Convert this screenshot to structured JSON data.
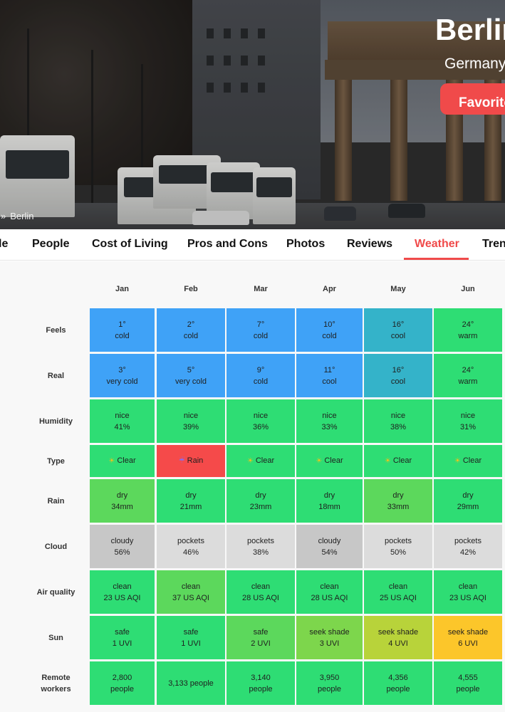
{
  "city": {
    "name": "Berlin",
    "country": "Germany",
    "favorite_label": "Favorite"
  },
  "breadcrumb": {
    "separator": "»",
    "current": "Berlin"
  },
  "tabs": [
    {
      "label": "le",
      "active": false
    },
    {
      "label": "People",
      "active": false
    },
    {
      "label": "Cost of Living",
      "active": false
    },
    {
      "label": "Pros and Cons",
      "active": false
    },
    {
      "label": "Photos",
      "active": false
    },
    {
      "label": "Reviews",
      "active": false
    },
    {
      "label": "Weather",
      "active": true
    },
    {
      "label": "Tren",
      "active": false
    }
  ],
  "months": [
    "Jan",
    "Feb",
    "Mar",
    "Apr",
    "May",
    "Jun"
  ],
  "rows": [
    {
      "label": "Feels",
      "cells": [
        {
          "l1": "1°",
          "l2": "cold",
          "color": "#3fa2f7"
        },
        {
          "l1": "2°",
          "l2": "cold",
          "color": "#3fa2f7"
        },
        {
          "l1": "7°",
          "l2": "cold",
          "color": "#3fa2f7"
        },
        {
          "l1": "10°",
          "l2": "cold",
          "color": "#3fa2f7"
        },
        {
          "l1": "16°",
          "l2": "cool",
          "color": "#34b3c9"
        },
        {
          "l1": "24°",
          "l2": "warm",
          "color": "#2edd74"
        }
      ]
    },
    {
      "label": "Real",
      "cells": [
        {
          "l1": "3°",
          "l2": "very cold",
          "color": "#3fa2f7"
        },
        {
          "l1": "5°",
          "l2": "very cold",
          "color": "#3fa2f7"
        },
        {
          "l1": "9°",
          "l2": "cold",
          "color": "#3fa2f7"
        },
        {
          "l1": "11°",
          "l2": "cool",
          "color": "#3fa2f7"
        },
        {
          "l1": "16°",
          "l2": "cool",
          "color": "#34b3c9"
        },
        {
          "l1": "24°",
          "l2": "warm",
          "color": "#2edd74"
        }
      ]
    },
    {
      "label": "Humidity",
      "cells": [
        {
          "l1": "nice",
          "l2": "41%",
          "color": "#2edd74"
        },
        {
          "l1": "nice",
          "l2": "39%",
          "color": "#2edd74"
        },
        {
          "l1": "nice",
          "l2": "36%",
          "color": "#2edd74"
        },
        {
          "l1": "nice",
          "l2": "33%",
          "color": "#2edd74"
        },
        {
          "l1": "nice",
          "l2": "38%",
          "color": "#2edd74"
        },
        {
          "l1": "nice",
          "l2": "31%",
          "color": "#2edd74"
        }
      ]
    },
    {
      "label": "Type",
      "single": true,
      "cells": [
        {
          "icon": "☀",
          "l1": "Clear",
          "color": "#2edd74"
        },
        {
          "icon": "☔",
          "l1": "Rain",
          "color": "#f54a4a"
        },
        {
          "icon": "☀",
          "l1": "Clear",
          "color": "#2edd74"
        },
        {
          "icon": "☀",
          "l1": "Clear",
          "color": "#2edd74"
        },
        {
          "icon": "☀",
          "l1": "Clear",
          "color": "#2edd74"
        },
        {
          "icon": "☀",
          "l1": "Clear",
          "color": "#2edd74"
        }
      ]
    },
    {
      "label": "Rain",
      "cells": [
        {
          "l1": "dry",
          "l2": "34mm",
          "color": "#5cd85c"
        },
        {
          "l1": "dry",
          "l2": "21mm",
          "color": "#2edd74"
        },
        {
          "l1": "dry",
          "l2": "23mm",
          "color": "#2edd74"
        },
        {
          "l1": "dry",
          "l2": "18mm",
          "color": "#2edd74"
        },
        {
          "l1": "dry",
          "l2": "33mm",
          "color": "#5cd85c"
        },
        {
          "l1": "dry",
          "l2": "29mm",
          "color": "#2edd74"
        }
      ]
    },
    {
      "label": "Cloud",
      "cells": [
        {
          "l1": "cloudy",
          "l2": "56%",
          "color": "#c7c7c7"
        },
        {
          "l1": "pockets",
          "l2": "46%",
          "color": "#dcdcdc"
        },
        {
          "l1": "pockets",
          "l2": "38%",
          "color": "#dcdcdc"
        },
        {
          "l1": "cloudy",
          "l2": "54%",
          "color": "#c7c7c7"
        },
        {
          "l1": "pockets",
          "l2": "50%",
          "color": "#dcdcdc"
        },
        {
          "l1": "pockets",
          "l2": "42%",
          "color": "#dcdcdc"
        }
      ]
    },
    {
      "label": "Air quality",
      "cells": [
        {
          "l1": "clean",
          "l2": "23 US AQI",
          "color": "#2edd74"
        },
        {
          "l1": "clean",
          "l2": "37 US AQI",
          "color": "#5cd85c"
        },
        {
          "l1": "clean",
          "l2": "28 US AQI",
          "color": "#2edd74"
        },
        {
          "l1": "clean",
          "l2": "28 US AQI",
          "color": "#2edd74"
        },
        {
          "l1": "clean",
          "l2": "25 US AQI",
          "color": "#2edd74"
        },
        {
          "l1": "clean",
          "l2": "23 US AQI",
          "color": "#2edd74"
        }
      ]
    },
    {
      "label": "Sun",
      "cells": [
        {
          "l1": "safe",
          "l2": "1 UVI",
          "color": "#2edd74"
        },
        {
          "l1": "safe",
          "l2": "1 UVI",
          "color": "#2edd74"
        },
        {
          "l1": "safe",
          "l2": "2 UVI",
          "color": "#5cd85c"
        },
        {
          "l1": "seek shade",
          "l2": "3 UVI",
          "color": "#7dd64c"
        },
        {
          "l1": "seek shade",
          "l2": "4 UVI",
          "color": "#b8d33a"
        },
        {
          "l1": "seek shade",
          "l2": "6 UVI",
          "color": "#fcc62a"
        }
      ]
    },
    {
      "label": "Remote workers",
      "label_l1": "Remote",
      "label_l2": "workers",
      "cells": [
        {
          "l1": "2,800",
          "l2": "people",
          "color": "#2edd74"
        },
        {
          "l1": "3,133 people",
          "single": true,
          "color": "#2edd74"
        },
        {
          "l1": "3,140",
          "l2": "people",
          "color": "#2edd74"
        },
        {
          "l1": "3,950",
          "l2": "people",
          "color": "#2edd74"
        },
        {
          "l1": "4,356",
          "l2": "people",
          "color": "#2edd74"
        },
        {
          "l1": "4,555",
          "l2": "people",
          "color": "#2edd74"
        }
      ]
    }
  ],
  "colors": {
    "accent": "#f04a4a",
    "cold": "#3fa2f7",
    "cool": "#34b3c9",
    "good": "#2edd74",
    "okay": "#5cd85c",
    "cloud_dark": "#c7c7c7",
    "cloud_light": "#dcdcdc",
    "warn": "#fcc62a"
  }
}
